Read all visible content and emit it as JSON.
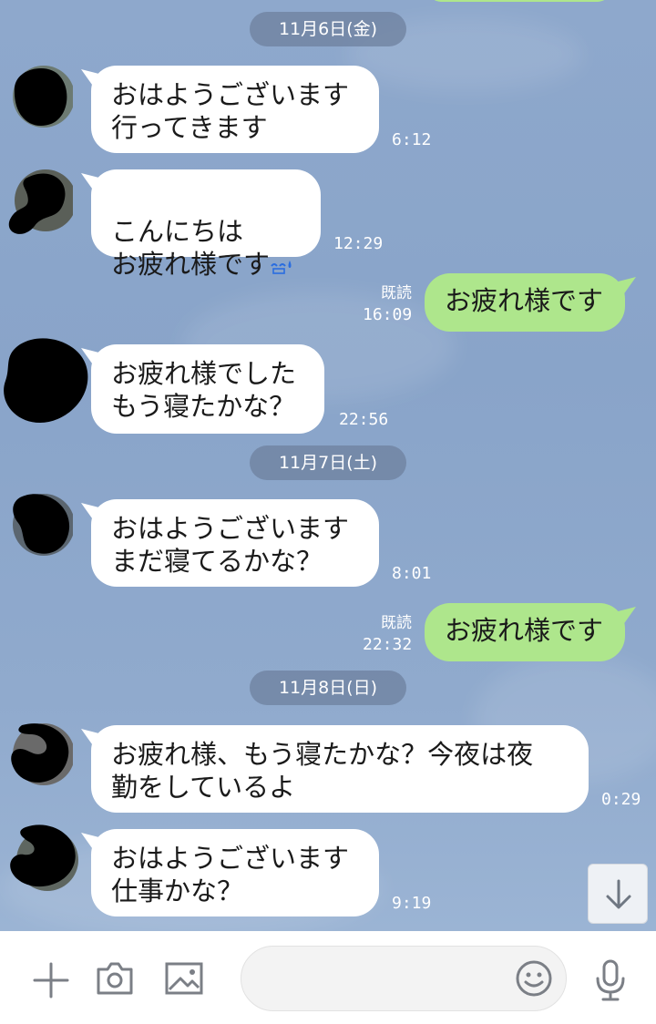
{
  "dates": {
    "d1": "11月6日(金)",
    "d2": "11月7日(土)",
    "d3": "11月8日(日)"
  },
  "messages": [
    {
      "text": "おはようございます\n行ってきます",
      "time": "6:12"
    },
    {
      "text": "こんにちは\nお疲れ様です",
      "emoji": "sweat-smile-emoji",
      "time": "12:29"
    },
    {
      "text": "お疲れ様です",
      "read": "既読",
      "time": "16:09"
    },
    {
      "text": "お疲れ様でした\nもう寝たかな？",
      "time": "22:56"
    },
    {
      "text": "おはようございます\nまだ寝てるかな？",
      "time": "8:01"
    },
    {
      "text": "お疲れ様です",
      "read": "既読",
      "time": "22:32"
    },
    {
      "text": "お疲れ様、もう寝たかな？今夜は夜\n勤をしているよ",
      "time": "0:29"
    },
    {
      "text": "おはようございます\n仕事かな？",
      "time": "9:19"
    }
  ],
  "icons": {
    "add": "plus-icon",
    "camera": "camera-icon",
    "image": "image-icon",
    "emoji": "smiley-icon",
    "mic": "microphone-icon",
    "scroll": "arrow-down-icon"
  },
  "colors": {
    "background": "#8ea8cc",
    "bubble_in": "#ffffff",
    "bubble_out": "#aee68c",
    "date_chip": "#6e809e"
  },
  "input": {
    "placeholder": ""
  }
}
